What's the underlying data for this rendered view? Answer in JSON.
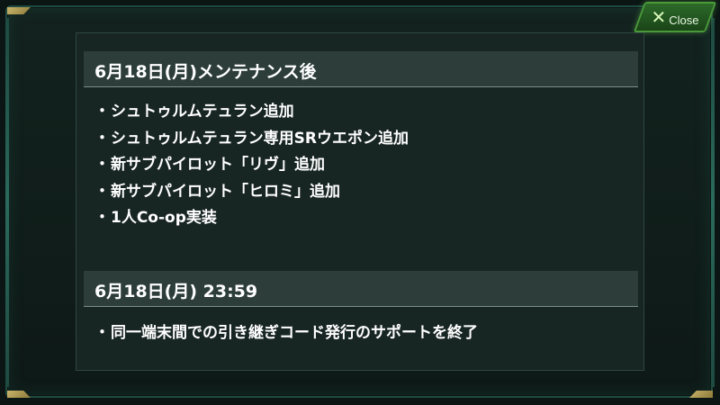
{
  "window": {
    "close_label": "Close",
    "close_icon": "close-x-icon"
  },
  "sections": [
    {
      "title": "6月18日(月)メンテナンス後",
      "items": [
        "シュトゥルムテュラン追加",
        "シュトゥルムテュラン専用SRウエポン追加",
        "新サブパイロット「リヴ」追加",
        "新サブパイロット「ヒロミ」追加",
        "1人Co-op実装"
      ]
    },
    {
      "title": "6月18日(月) 23:59",
      "items": [
        "同一端末間での引き継ぎコード発行のサポートを終了"
      ]
    }
  ],
  "bullet": "・",
  "colors": {
    "background": "#0b1614",
    "panel": "#182623",
    "header": "#2c3d3a",
    "close_button": "#2d6b2a",
    "accent_gold": "#c9b46a"
  }
}
